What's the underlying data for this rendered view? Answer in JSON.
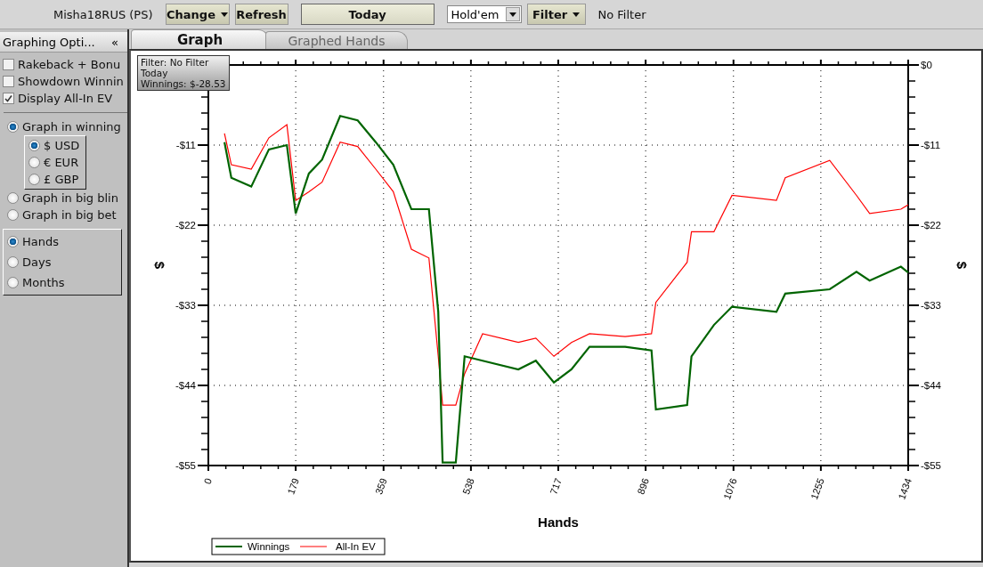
{
  "toolbar": {
    "player": "Misha18RUS (PS)",
    "buttons": [
      {
        "label": "Change",
        "kind": "dropdown"
      },
      {
        "label": "Refresh",
        "kind": "plain"
      },
      {
        "label": "Today",
        "kind": "wide"
      }
    ],
    "game_select": {
      "value": "Hold'em"
    },
    "filter_button": {
      "label": "Filter"
    },
    "filter_status": "No Filter"
  },
  "sidebar": {
    "title": "Graphing Opti...",
    "collapse": "«",
    "checkboxes": [
      {
        "label": "Rakeback + Bonu",
        "checked": false
      },
      {
        "label": "Showdown Winnin",
        "checked": false
      },
      {
        "label": "Display All-In EV",
        "checked": true
      }
    ],
    "units": [
      {
        "label": "Graph in winning",
        "selected": true,
        "currencies": [
          {
            "label": "$ USD",
            "selected": true
          },
          {
            "label": "€ EUR",
            "selected": false
          },
          {
            "label": "£ GBP",
            "selected": false
          }
        ]
      },
      {
        "label": "Graph in big blin",
        "selected": false
      },
      {
        "label": "Graph in big bet",
        "selected": false
      }
    ],
    "periods": [
      {
        "label": "Hands",
        "selected": true
      },
      {
        "label": "Days",
        "selected": false
      },
      {
        "label": "Months",
        "selected": false
      }
    ]
  },
  "tabs": [
    {
      "label": "Graph",
      "selected": true
    },
    {
      "label": "Graphed Hands",
      "selected": false
    }
  ],
  "tooltip": [
    "Filter: No Filter",
    "Today",
    "Winnings: $-28.53"
  ],
  "chart": {
    "chart_data": {
      "type": "line",
      "xlabel": "Hands",
      "ylabel": "$",
      "grid": true,
      "legend": true,
      "x": [
        33,
        47,
        88,
        124,
        161,
        179,
        206,
        233,
        270,
        306,
        343,
        379,
        416,
        452,
        471,
        480,
        507,
        525,
        562,
        635,
        671,
        708,
        744,
        781,
        854,
        908,
        917,
        981,
        990,
        1036,
        1073,
        1164,
        1182,
        1273,
        1328,
        1355,
        1419,
        1434
      ],
      "series": [
        {
          "name": "Winnings",
          "color": "#006400",
          "values": [
            -10.6,
            -15.5,
            -16.7,
            -11.6,
            -11,
            -20.4,
            -14.9,
            -13,
            -7,
            -7.6,
            -10.6,
            -13.7,
            -19.8,
            -19.8,
            -33.9,
            -54.6,
            -54.6,
            -40,
            -40.6,
            -41.8,
            -40.6,
            -43.6,
            -41.8,
            -38.7,
            -38.7,
            -39.2,
            -47.3,
            -46.7,
            -40,
            -35.7,
            -33.2,
            -33.9,
            -31.4,
            -30.8,
            -28.4,
            -29.6,
            -27.7,
            -28.5
          ]
        },
        {
          "name": "All-In EV",
          "color": "#ff0000",
          "values": [
            -9.4,
            -13.7,
            -14.3,
            -10,
            -8.2,
            -18.6,
            -17.4,
            -16.1,
            -10.6,
            -11.2,
            -14.3,
            -17.4,
            -25.3,
            -26.5,
            -40,
            -46.7,
            -46.7,
            -42.4,
            -36.9,
            -38.1,
            -37.5,
            -40,
            -38.1,
            -36.9,
            -37.3,
            -36.9,
            -32.6,
            -27.1,
            -22.9,
            -22.9,
            -17.9,
            -18.6,
            -15.5,
            -13.1,
            -17.9,
            -20.4,
            -19.8,
            -19.2
          ]
        }
      ],
      "xlim": [
        0,
        1434
      ],
      "ylim": [
        -55,
        0
      ],
      "xticks": [
        0,
        179,
        359,
        538,
        717,
        896,
        1076,
        1255,
        1434
      ],
      "yticks": [
        {
          "value": 0,
          "label": "$0"
        },
        {
          "value": -11,
          "label": "-$11"
        },
        {
          "value": -22,
          "label": "-$22"
        },
        {
          "value": -33,
          "label": "-$33"
        },
        {
          "value": -44,
          "label": "-$44"
        },
        {
          "value": -55,
          "label": "-$55"
        }
      ]
    }
  }
}
